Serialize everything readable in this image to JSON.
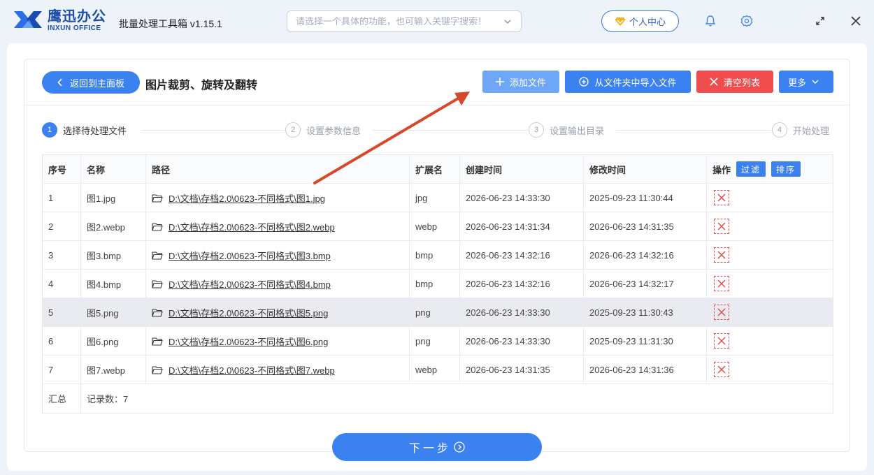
{
  "app": {
    "brand_cn": "鹰迅办公",
    "brand_en": "INXUN OFFICE",
    "title": "批量处理工具箱 v1.15.1",
    "search_placeholder": "请选择一个具体的功能，也可输入关键字搜索！",
    "user_center": "个人中心"
  },
  "page": {
    "back_label": "返回到主面板",
    "title": "图片裁剪、旋转及翻转",
    "toolbar": {
      "add_file": "添加文件",
      "import_folder": "从文件夹中导入文件",
      "clear_list": "清空列表",
      "more": "更多"
    }
  },
  "steps": [
    {
      "num": "1",
      "label": "选择待处理文件",
      "active": true
    },
    {
      "num": "2",
      "label": "设置参数信息",
      "active": false
    },
    {
      "num": "3",
      "label": "设置输出目录",
      "active": false
    },
    {
      "num": "4",
      "label": "开始处理",
      "active": false
    }
  ],
  "table": {
    "headers": {
      "index": "序号",
      "name": "名称",
      "path": "路径",
      "ext": "扩展名",
      "created": "创建时间",
      "modified": "修改时间",
      "action": "操作",
      "filter": "过滤",
      "sort": "排序"
    },
    "rows": [
      {
        "index": "1",
        "name": "图1.jpg",
        "path": "D:\\文档\\存档2.0\\0623-不同格式\\图1.jpg",
        "ext": "jpg",
        "created": "2026-06-23 14:33:30",
        "modified": "2025-09-23 11:30:44"
      },
      {
        "index": "2",
        "name": "图2.webp",
        "path": "D:\\文档\\存档2.0\\0623-不同格式\\图2.webp",
        "ext": "webp",
        "created": "2026-06-23 14:31:34",
        "modified": "2026-06-23 14:31:35"
      },
      {
        "index": "3",
        "name": "图3.bmp",
        "path": "D:\\文档\\存档2.0\\0623-不同格式\\图3.bmp",
        "ext": "bmp",
        "created": "2026-06-23 14:32:16",
        "modified": "2026-06-23 14:32:16"
      },
      {
        "index": "4",
        "name": "图4.bmp",
        "path": "D:\\文档\\存档2.0\\0623-不同格式\\图4.bmp",
        "ext": "bmp",
        "created": "2026-06-23 14:32:16",
        "modified": "2026-06-23 14:32:17"
      },
      {
        "index": "5",
        "name": "图5.png",
        "path": "D:\\文档\\存档2.0\\0623-不同格式\\图5.png",
        "ext": "png",
        "created": "2026-06-23 14:33:30",
        "modified": "2025-09-23 11:30:43"
      },
      {
        "index": "6",
        "name": "图6.png",
        "path": "D:\\文档\\存档2.0\\0623-不同格式\\图6.png",
        "ext": "png",
        "created": "2026-06-23 14:33:30",
        "modified": "2025-09-23 11:31:30"
      },
      {
        "index": "7",
        "name": "图7.webp",
        "path": "D:\\文档\\存档2.0\\0623-不同格式\\图7.webp",
        "ext": "webp",
        "created": "2026-06-23 14:31:35",
        "modified": "2026-06-23 14:31:36"
      }
    ],
    "summary_label": "汇总",
    "summary_count": "记录数：7"
  },
  "next_label": "下一步",
  "colors": {
    "primary": "#3b82f0",
    "danger": "#f04e4e",
    "annotation_arrow": "#d9472b"
  }
}
